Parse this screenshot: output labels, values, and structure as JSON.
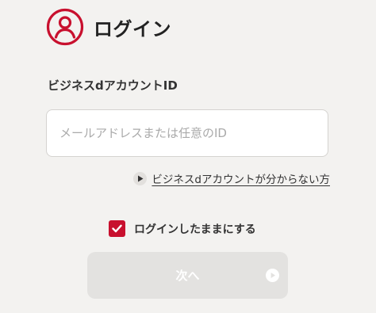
{
  "header": {
    "title": "ログイン",
    "icon": "user-circle-icon"
  },
  "form": {
    "id_label": "ビジネスdアカウントID",
    "id_input": {
      "value": "",
      "placeholder": "メールアドレスまたは任意のID"
    },
    "help_link": {
      "label": "ビジネスdアカウントが分からない方",
      "icon": "play-circle-icon"
    },
    "remember": {
      "label": "ログインしたままにする",
      "checked": true
    },
    "next_button": {
      "label": "次へ",
      "enabled": false,
      "icon": "play-circle-icon"
    }
  },
  "colors": {
    "accent": "#c8102e",
    "background": "#f3f2f0",
    "button_disabled": "#e3e2e0"
  }
}
